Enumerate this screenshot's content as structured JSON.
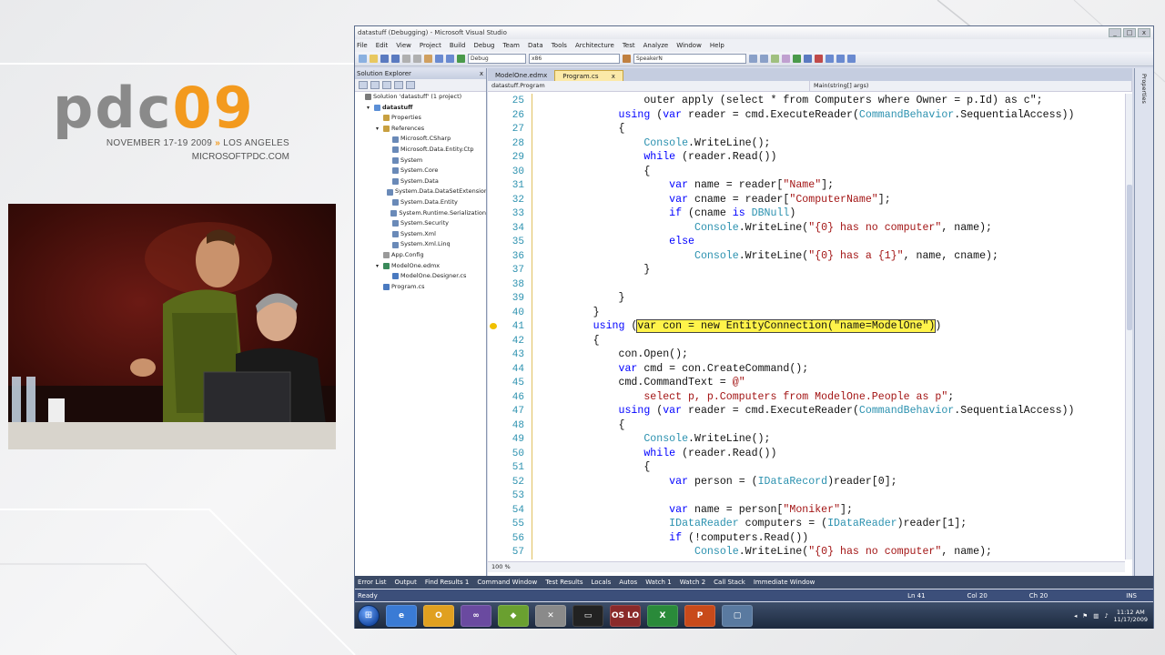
{
  "brand": {
    "logo_pdc": "pdc",
    "logo_09": "09",
    "date": "NOVEMBER 17-19 2009",
    "arrows": "»",
    "city": "LOS ANGELES",
    "site": "MICROSOFTPDC.COM"
  },
  "window": {
    "title": "datastuff (Debugging) - Microsoft Visual Studio",
    "controls": [
      "_",
      "□",
      "x"
    ]
  },
  "menu": [
    "File",
    "Edit",
    "View",
    "Project",
    "Build",
    "Debug",
    "Team",
    "Data",
    "Tools",
    "Architecture",
    "Test",
    "Analyze",
    "Window",
    "Help"
  ],
  "toolbar": {
    "config": "Debug",
    "platform": "x86",
    "find_combo": "SpeakerN"
  },
  "solution_explorer": {
    "title": "Solution Explorer",
    "close": "x",
    "items": [
      {
        "label": "Solution 'datastuff' (1 project)",
        "indent": 0,
        "icon_color": "#7a7a7a",
        "exp": ""
      },
      {
        "label": "datastuff",
        "indent": 1,
        "icon_color": "#5b8fd6",
        "exp": "▾",
        "bold": true
      },
      {
        "label": "Properties",
        "indent": 2,
        "icon_color": "#c8a040",
        "exp": ""
      },
      {
        "label": "References",
        "indent": 2,
        "icon_color": "#c8a040",
        "exp": "▾"
      },
      {
        "label": "Microsoft.CSharp",
        "indent": 3,
        "icon_color": "#6a8ab8",
        "exp": ""
      },
      {
        "label": "Microsoft.Data.Entity.Ctp",
        "indent": 3,
        "icon_color": "#6a8ab8",
        "exp": ""
      },
      {
        "label": "System",
        "indent": 3,
        "icon_color": "#6a8ab8",
        "exp": ""
      },
      {
        "label": "System.Core",
        "indent": 3,
        "icon_color": "#6a8ab8",
        "exp": ""
      },
      {
        "label": "System.Data",
        "indent": 3,
        "icon_color": "#6a8ab8",
        "exp": ""
      },
      {
        "label": "System.Data.DataSetExtensions",
        "indent": 3,
        "icon_color": "#6a8ab8",
        "exp": ""
      },
      {
        "label": "System.Data.Entity",
        "indent": 3,
        "icon_color": "#6a8ab8",
        "exp": ""
      },
      {
        "label": "System.Runtime.Serialization",
        "indent": 3,
        "icon_color": "#6a8ab8",
        "exp": ""
      },
      {
        "label": "System.Security",
        "indent": 3,
        "icon_color": "#6a8ab8",
        "exp": ""
      },
      {
        "label": "System.Xml",
        "indent": 3,
        "icon_color": "#6a8ab8",
        "exp": ""
      },
      {
        "label": "System.Xml.Linq",
        "indent": 3,
        "icon_color": "#6a8ab8",
        "exp": ""
      },
      {
        "label": "App.Config",
        "indent": 2,
        "icon_color": "#9a9a9a",
        "exp": ""
      },
      {
        "label": "ModelOne.edmx",
        "indent": 2,
        "icon_color": "#3a8a5a",
        "exp": "▾"
      },
      {
        "label": "ModelOne.Designer.cs",
        "indent": 3,
        "icon_color": "#4a7ac0",
        "exp": ""
      },
      {
        "label": "Program.cs",
        "indent": 2,
        "icon_color": "#4a7ac0",
        "exp": ""
      }
    ]
  },
  "editor": {
    "tabs": [
      {
        "label": "ModelOne.edmx",
        "active": false
      },
      {
        "label": "Program.cs",
        "active": true
      }
    ],
    "tab_close": "x",
    "nav_class": "datastuff.Program",
    "nav_member": "Main(string[] args)",
    "zoom": "100 %"
  },
  "code": [
    {
      "n": "25",
      "parts": [
        [
          "t",
          "                outer apply (select * from Computers where Owner = p.Id) as c\";"
        ]
      ]
    },
    {
      "n": "26",
      "parts": [
        [
          "t",
          "            "
        ],
        [
          "k",
          "using"
        ],
        [
          "t",
          " ("
        ],
        [
          "k",
          "var"
        ],
        [
          "t",
          " reader = cmd.ExecuteReader("
        ],
        [
          "y",
          "CommandBehavior"
        ],
        [
          "t",
          ".SequentialAccess))"
        ]
      ]
    },
    {
      "n": "27",
      "parts": [
        [
          "t",
          "            {"
        ]
      ]
    },
    {
      "n": "28",
      "parts": [
        [
          "t",
          "                "
        ],
        [
          "y",
          "Console"
        ],
        [
          "t",
          ".WriteLine();"
        ]
      ]
    },
    {
      "n": "29",
      "parts": [
        [
          "t",
          "                "
        ],
        [
          "k",
          "while"
        ],
        [
          "t",
          " (reader.Read())"
        ]
      ]
    },
    {
      "n": "30",
      "parts": [
        [
          "t",
          "                {"
        ]
      ]
    },
    {
      "n": "31",
      "parts": [
        [
          "t",
          "                    "
        ],
        [
          "k",
          "var"
        ],
        [
          "t",
          " name = reader["
        ],
        [
          "s",
          "\"Name\""
        ],
        [
          "t",
          "];"
        ]
      ]
    },
    {
      "n": "32",
      "parts": [
        [
          "t",
          "                    "
        ],
        [
          "k",
          "var"
        ],
        [
          "t",
          " cname = reader["
        ],
        [
          "s",
          "\"ComputerName\""
        ],
        [
          "t",
          "];"
        ]
      ]
    },
    {
      "n": "33",
      "parts": [
        [
          "t",
          "                    "
        ],
        [
          "k",
          "if"
        ],
        [
          "t",
          " (cname "
        ],
        [
          "k",
          "is"
        ],
        [
          "t",
          " "
        ],
        [
          "y",
          "DBNull"
        ],
        [
          "t",
          ")"
        ]
      ]
    },
    {
      "n": "34",
      "parts": [
        [
          "t",
          "                        "
        ],
        [
          "y",
          "Console"
        ],
        [
          "t",
          ".WriteLine("
        ],
        [
          "s",
          "\"{0} has no computer\""
        ],
        [
          "t",
          ", name);"
        ]
      ]
    },
    {
      "n": "35",
      "parts": [
        [
          "t",
          "                    "
        ],
        [
          "k",
          "else"
        ]
      ]
    },
    {
      "n": "36",
      "parts": [
        [
          "t",
          "                        "
        ],
        [
          "y",
          "Console"
        ],
        [
          "t",
          ".WriteLine("
        ],
        [
          "s",
          "\"{0} has a {1}\""
        ],
        [
          "t",
          ", name, cname);"
        ]
      ]
    },
    {
      "n": "37",
      "parts": [
        [
          "t",
          "                }"
        ]
      ]
    },
    {
      "n": "38",
      "parts": [
        [
          "t",
          ""
        ]
      ]
    },
    {
      "n": "39",
      "parts": [
        [
          "t",
          "            }"
        ]
      ]
    },
    {
      "n": "40",
      "parts": [
        [
          "t",
          "        }"
        ]
      ]
    },
    {
      "n": "41",
      "bp": true,
      "parts": [
        [
          "t",
          "        "
        ],
        [
          "k",
          "using"
        ],
        [
          "t",
          " ("
        ],
        [
          "h",
          "var con = new EntityConnection(\"name=ModelOne\")"
        ],
        [
          "t",
          ")"
        ]
      ]
    },
    {
      "n": "42",
      "parts": [
        [
          "t",
          "        {"
        ]
      ]
    },
    {
      "n": "43",
      "parts": [
        [
          "t",
          "            con.Open();"
        ]
      ]
    },
    {
      "n": "44",
      "parts": [
        [
          "t",
          "            "
        ],
        [
          "k",
          "var"
        ],
        [
          "t",
          " cmd = con.CreateCommand();"
        ]
      ]
    },
    {
      "n": "45",
      "parts": [
        [
          "t",
          "            cmd.CommandText = "
        ],
        [
          "s",
          "@\""
        ]
      ]
    },
    {
      "n": "46",
      "parts": [
        [
          "s",
          "                select p, p.Computers from ModelOne.People as p\""
        ],
        [
          "t",
          ";"
        ]
      ]
    },
    {
      "n": "47",
      "parts": [
        [
          "t",
          "            "
        ],
        [
          "k",
          "using"
        ],
        [
          "t",
          " ("
        ],
        [
          "k",
          "var"
        ],
        [
          "t",
          " reader = cmd.ExecuteReader("
        ],
        [
          "y",
          "CommandBehavior"
        ],
        [
          "t",
          ".SequentialAccess))"
        ]
      ]
    },
    {
      "n": "48",
      "parts": [
        [
          "t",
          "            {"
        ]
      ]
    },
    {
      "n": "49",
      "parts": [
        [
          "t",
          "                "
        ],
        [
          "y",
          "Console"
        ],
        [
          "t",
          ".WriteLine();"
        ]
      ]
    },
    {
      "n": "50",
      "parts": [
        [
          "t",
          "                "
        ],
        [
          "k",
          "while"
        ],
        [
          "t",
          " (reader.Read())"
        ]
      ]
    },
    {
      "n": "51",
      "parts": [
        [
          "t",
          "                {"
        ]
      ]
    },
    {
      "n": "52",
      "parts": [
        [
          "t",
          "                    "
        ],
        [
          "k",
          "var"
        ],
        [
          "t",
          " person = ("
        ],
        [
          "y",
          "IDataRecord"
        ],
        [
          "t",
          ")reader[0];"
        ]
      ]
    },
    {
      "n": "53",
      "parts": [
        [
          "t",
          ""
        ]
      ]
    },
    {
      "n": "54",
      "parts": [
        [
          "t",
          "                    "
        ],
        [
          "k",
          "var"
        ],
        [
          "t",
          " name = person["
        ],
        [
          "s",
          "\"Moniker\""
        ],
        [
          "t",
          "];"
        ]
      ]
    },
    {
      "n": "55",
      "parts": [
        [
          "t",
          "                    "
        ],
        [
          "y",
          "IDataReader"
        ],
        [
          "t",
          " computers = ("
        ],
        [
          "y",
          "IDataReader"
        ],
        [
          "t",
          ")reader[1];"
        ]
      ]
    },
    {
      "n": "56",
      "parts": [
        [
          "t",
          "                    "
        ],
        [
          "k",
          "if"
        ],
        [
          "t",
          " (!computers.Read())"
        ]
      ]
    },
    {
      "n": "57",
      "parts": [
        [
          "t",
          "                        "
        ],
        [
          "y",
          "Console"
        ],
        [
          "t",
          ".WriteLine("
        ],
        [
          "s",
          "\"{0} has no computer\""
        ],
        [
          "t",
          ", name);"
        ]
      ]
    }
  ],
  "properties_label": "Properties",
  "tool_tabs": [
    "Error List",
    "Output",
    "Find Results 1",
    "Command Window",
    "Test Results",
    "Locals",
    "Autos",
    "Watch 1",
    "Watch 2",
    "Call Stack",
    "Immediate Window"
  ],
  "status": {
    "text": "Ready",
    "ln": "Ln 41",
    "col": "Col 20",
    "ch": "Ch 20",
    "ins": "INS"
  },
  "taskbar": {
    "apps": [
      {
        "name": "ie",
        "label": "e",
        "color": "#3a7bd5"
      },
      {
        "name": "outlook",
        "label": "O",
        "color": "#e0a020"
      },
      {
        "name": "vs",
        "label": "∞",
        "color": "#6a4aa0"
      },
      {
        "name": "app-green",
        "label": "◆",
        "color": "#6aa030"
      },
      {
        "name": "tools",
        "label": "✕",
        "color": "#8a8a8a"
      },
      {
        "name": "cmd",
        "label": "▭",
        "color": "#222222"
      },
      {
        "name": "oslo",
        "label": "OS LO",
        "color": "#8a2a2a"
      },
      {
        "name": "excel",
        "label": "X",
        "color": "#2a8a3a"
      },
      {
        "name": "powerpoint",
        "label": "P",
        "color": "#c84a1a"
      },
      {
        "name": "window",
        "label": "▢",
        "color": "#5a7aa0"
      }
    ],
    "time": "11:12 AM",
    "date": "11/17/2009"
  },
  "colors": {
    "accent_orange": "#f39a1e",
    "highlight": "#fff34a",
    "keyword": "#0000ff",
    "string": "#a31515",
    "type": "#2b91af"
  }
}
